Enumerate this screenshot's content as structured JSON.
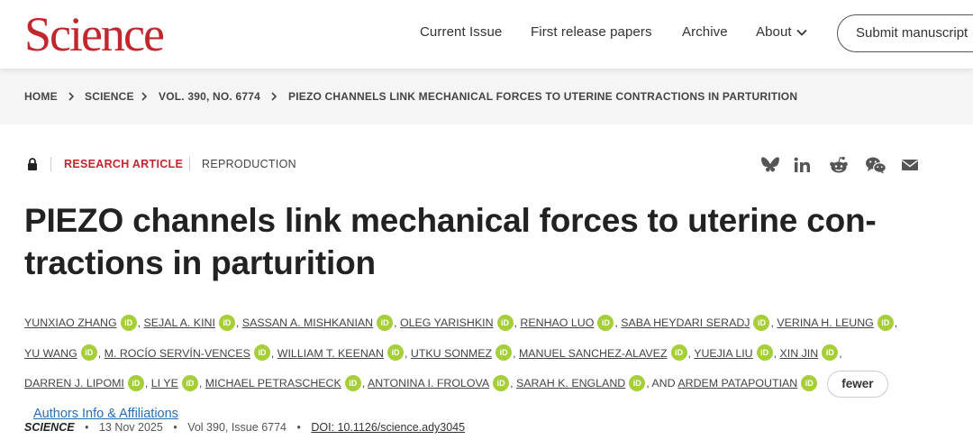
{
  "header": {
    "logo": "Science",
    "nav": {
      "current_issue": "Current Issue",
      "first_release": "First release papers",
      "archive": "Archive",
      "about": "About"
    },
    "submit": "Submit manuscript"
  },
  "breadcrumb": {
    "items": [
      "HOME",
      "SCIENCE",
      "VOL. 390, NO. 6774",
      "PIEZO CHANNELS LINK MECHANICAL FORCES TO UTERINE CONTRACTIONS IN PARTURITION"
    ]
  },
  "article": {
    "type": "RESEARCH ARTICLE",
    "tag": "REPRODUCTION",
    "title": "PIEZO channels link mechanical forces to uterine con-tractions in parturition",
    "authors": [
      "YUNXIAO ZHANG",
      "SEJAL A. KINI",
      "SASSAN A. MISHKANIAN",
      "OLEG YARISHKIN",
      "RENHAO LUO",
      "SABA HEYDARI SERADJ",
      "VERINA H. LEUNG",
      "YU WANG",
      "M. ROCÍO SERVÍN-VENCES",
      "WILLIAM T. KEENAN",
      "UTKU SONMEZ",
      "MANUEL SANCHEZ-ALAVEZ",
      "YUEJIA LIU",
      "XIN JIN",
      "DARREN J. LIPOMI",
      "LI YE",
      "MICHAEL PETRASCHECK",
      "ANTONINA I. FROLOVA",
      "SARAH K. ENGLAND",
      "ARDEM PATAPOUTIAN"
    ],
    "orcid_label": "iD",
    "and_label": "AND",
    "fewer_label": "fewer",
    "affiliations_label": "Authors Info & Affiliations"
  },
  "citation": {
    "journal": "SCIENCE",
    "date": "13 Nov 2025",
    "volume": "Vol 390, Issue 6774",
    "doi": "DOI: 10.1126/science.ady3045",
    "separator": "•"
  },
  "icons": [
    "lock-icon",
    "bluesky-icon",
    "linkedin-icon",
    "reddit-icon",
    "wechat-icon",
    "email-icon",
    "chevron-down-icon",
    "chevron-right-icon",
    "orcid-icon"
  ],
  "colors": {
    "brand": "#c1272d",
    "orcid": "#a6ce39",
    "link": "#2a6db5"
  }
}
